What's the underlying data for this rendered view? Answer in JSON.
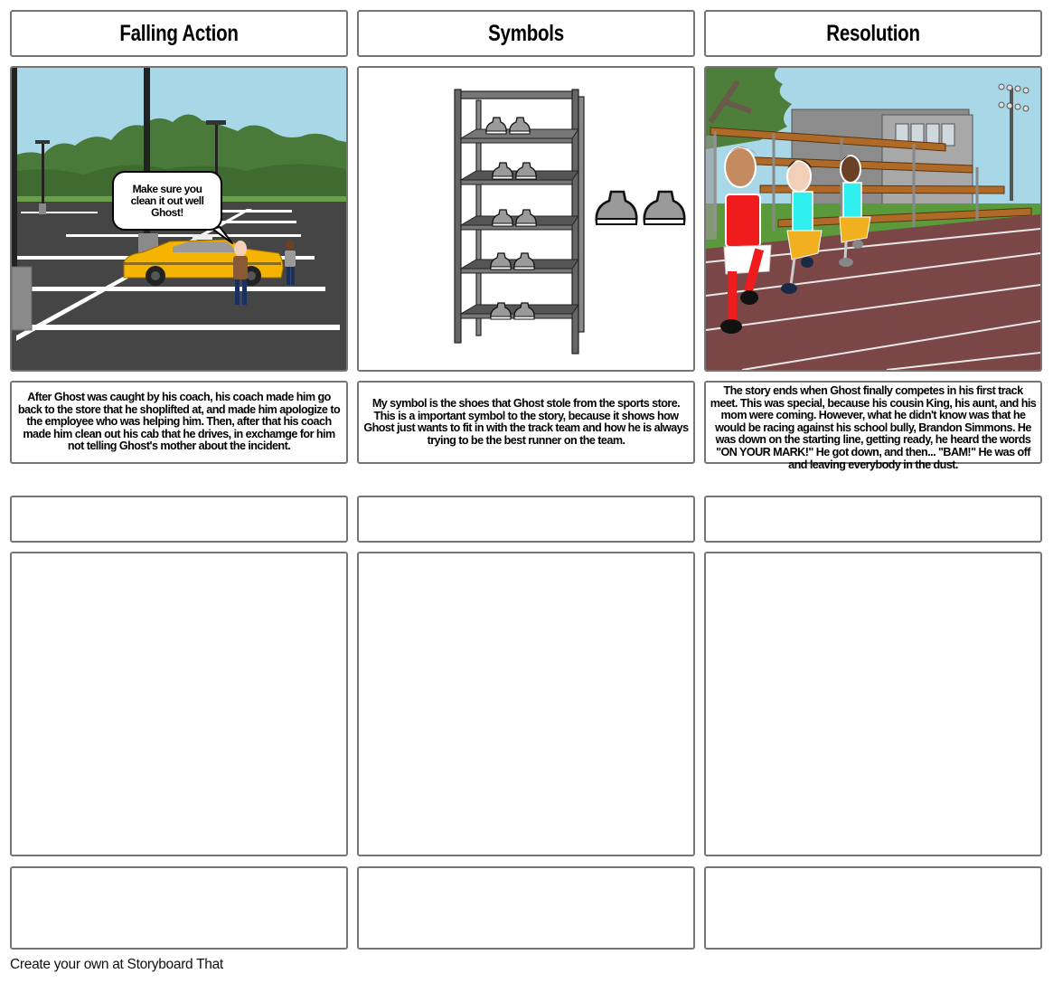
{
  "storyboard": {
    "row1": [
      {
        "title": "Falling Action",
        "scene": "parking-lot-taxi",
        "speech_bubble": "Make sure you clean it out well Ghost!",
        "description": "After Ghost was caught by his coach, his coach made him go back to the store that he shoplifted at, and made him apologize to the employee who was helping him. Then, after that his coach made him clean out his cab that he drives, in exchamge for him not telling Ghost's mother about the incident."
      },
      {
        "title": "Symbols",
        "scene": "shoe-shelf",
        "description": "My symbol is the shoes that Ghost stole from the sports store. This is a important symbol to the story, because it shows how Ghost just wants to fit in with the track team and how he is always trying to be the best runner on the team."
      },
      {
        "title": "Resolution",
        "scene": "track-meet",
        "description": "The story ends when Ghost finally competes in his first track meet. This was special, because his cousin King, his aunt, and his mom were coming. However, what he didn't know was that he would be racing against his school bully, Brandon Simmons. He was down on the starting line, getting ready, he heard the words \"ON YOUR MARK!\" He got down, and then... \"BAM!\" He was off and leaving everybody in the dust."
      }
    ],
    "row2": [
      {
        "title": "",
        "description": ""
      },
      {
        "title": "",
        "description": ""
      },
      {
        "title": "",
        "description": ""
      }
    ]
  },
  "colors": {
    "border": "#757575",
    "sky": "#a8d8e8",
    "asphalt": "#454545",
    "taxi": "#f5b400",
    "track": "#7a4646",
    "jersey_red": "#ee1c1c",
    "jersey_cyan": "#2ff0ee",
    "shorts_yellow": "#f0b020"
  },
  "footer": {
    "link_text": "Create your own at Storyboard That"
  }
}
